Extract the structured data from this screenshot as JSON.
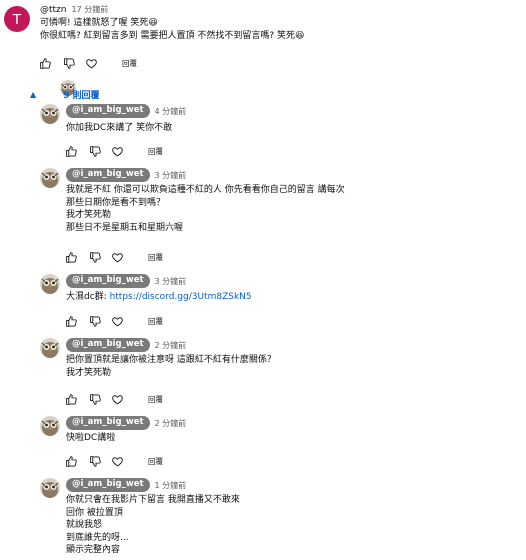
{
  "top_comment": {
    "avatar_letter": "T",
    "author": "@ttzn",
    "time": "17 分鐘前",
    "lines": [
      "可憐啊! 這樣就怒了喔 笑死😆",
      "你很紅嗎? 紅到留言多到 需要把人置頂  不然找不到留言嗎? 笑死😆"
    ],
    "reply_label": "回覆"
  },
  "replies_toggle": {
    "label": "9 則回覆"
  },
  "replies": [
    {
      "author": "@i_am_big_wet",
      "time": "4 分鐘前",
      "lines": [
        "你加我DC來講了 笑你不敢"
      ],
      "reply_label": "回覆"
    },
    {
      "author": "@i_am_big_wet",
      "time": "3 分鐘前",
      "lines": [
        "我就是不紅 你還可以欺負這種不紅的人 你先看看你自己的留言 講每次",
        "那些日期你是看不到嗎？",
        "我才笑死勒",
        "那些日不是星期五和星期六喔"
      ],
      "reply_label": "回覆"
    },
    {
      "author": "@i_am_big_wet",
      "time": "3 分鐘前",
      "lines_prefix": "大濕dc群: ",
      "link": "https://discord.gg/3Utm8ZSkN5",
      "reply_label": "回覆"
    },
    {
      "author": "@i_am_big_wet",
      "time": "2 分鐘前",
      "lines": [
        "把你置頂就是讓你被注意呀 這跟紅不紅有什麼關係？",
        "我才笑死勒"
      ],
      "reply_label": "回覆"
    },
    {
      "author": "@i_am_big_wet",
      "time": "2 分鐘前",
      "lines": [
        "快啦DC講啦"
      ],
      "reply_label": "回覆"
    },
    {
      "author": "@i_am_big_wet",
      "time": "1 分鐘前",
      "lines": [
        "你就只會在我影片下留言 我開直播又不敢來",
        "回你 被拉置頂",
        "就說我怒",
        "到底誰先的呀...",
        "顯示完整內容"
      ]
    }
  ]
}
